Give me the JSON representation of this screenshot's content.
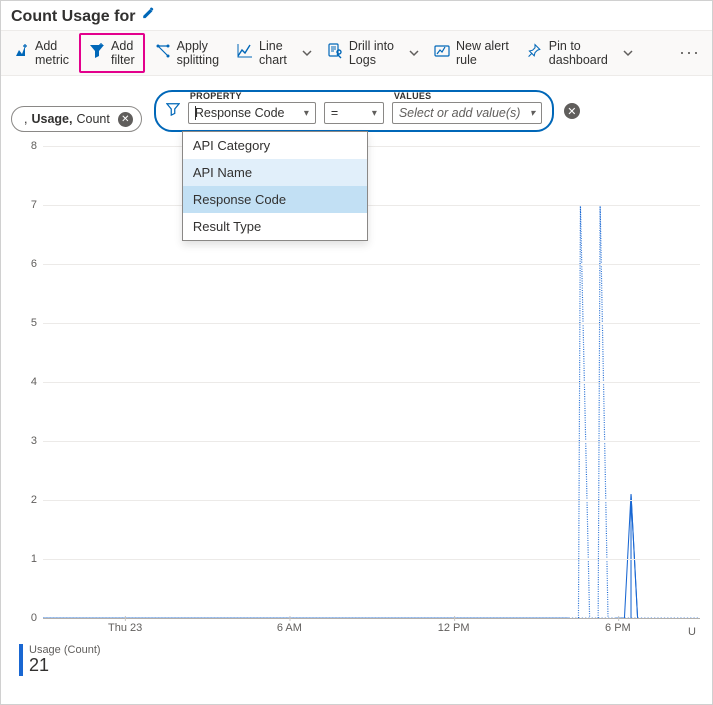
{
  "header": {
    "title": "Count Usage for"
  },
  "toolbar": {
    "add_metric": "Add\nmetric",
    "add_filter": "Add\nfilter",
    "apply_splitting": "Apply\nsplitting",
    "line_chart": "Line\nchart",
    "drill_logs": "Drill into\nLogs",
    "new_alert": "New alert\nrule",
    "pin_dashboard": "Pin to\ndashboard"
  },
  "metric_pill": {
    "prefix": ", ",
    "metric": "Usage,",
    "agg": " Count"
  },
  "filter": {
    "property_label": "PROPERTY",
    "values_label": "VALUES",
    "property_value": "Response Code",
    "operator_value": "=",
    "values_placeholder": "Select or add value(s)",
    "dropdown_options": [
      "API Category",
      "API Name",
      "Response Code",
      "Result Type"
    ],
    "dropdown_hover_index": 1,
    "dropdown_selected_index": 2
  },
  "chart_data": {
    "type": "line",
    "ylim": [
      0,
      8
    ],
    "y_ticks": [
      0,
      1,
      2,
      3,
      4,
      5,
      6,
      7,
      8
    ],
    "x_ticks": [
      {
        "pos": 0.125,
        "label": "Thu 23"
      },
      {
        "pos": 0.375,
        "label": "6 AM"
      },
      {
        "pos": 0.625,
        "label": "12 PM"
      },
      {
        "pos": 0.875,
        "label": "6 PM"
      }
    ],
    "series": [
      {
        "name": "Usage (Count)",
        "color": "#1967d2",
        "points": [
          [
            0.0,
            0
          ],
          [
            0.8,
            0
          ],
          [
            0.815,
            0
          ],
          [
            0.818,
            21
          ],
          [
            0.832,
            0
          ],
          [
            0.845,
            0
          ],
          [
            0.848,
            21
          ],
          [
            0.86,
            0
          ],
          [
            0.872,
            0
          ],
          [
            0.885,
            0
          ],
          [
            0.895,
            2.1
          ],
          [
            0.905,
            0
          ],
          [
            1.0,
            0
          ]
        ],
        "clipped_y": 7,
        "dotted_on_plateau": true
      }
    ],
    "legend_label": "Usage (Count)",
    "legend_value": "21",
    "right_trunc": "U"
  }
}
